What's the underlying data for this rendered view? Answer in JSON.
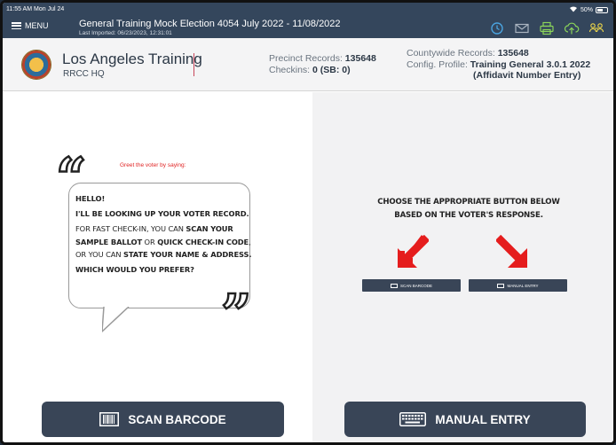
{
  "status_bar": {
    "time": "11:55 AM  Mon Jul 24",
    "battery": "50%"
  },
  "nav": {
    "menu_label": "MENU",
    "title": "General Training Mock Election 4054  July 2022  - 11/08/2022",
    "subtitle": "Last Imported: 06/23/2023, 12:31:01",
    "icons": [
      "history-icon",
      "mail-icon",
      "printer-icon",
      "cloud-upload-icon",
      "users-icon"
    ]
  },
  "info": {
    "org_name": "Los Angeles Training",
    "org_sub": "RRCC HQ",
    "precinct_label": "Precinct Records:",
    "precinct_value": "135648",
    "checkins_label": "Checkins:",
    "checkins_value": "0 (SB: 0)",
    "countywide_label": "Countywide Records:",
    "countywide_value": "135648",
    "config_label": "Config. Profile:",
    "config_value": "Training General 3.0.1 2022",
    "config_value_2": "(Affidavit Number Entry)"
  },
  "script": {
    "greet": "Greet the voter by saying:",
    "line1": "Hello!",
    "line2": "I'll be looking up your voter record.",
    "line3a": "For fast check-in, you can ",
    "line3b": "scan your sample ballot",
    "line3c": " or ",
    "line3d": "quick check-in code",
    "line3e": ", or you can ",
    "line3f": "state your name & address.",
    "line4": "Which would you prefer?"
  },
  "instruction": {
    "line1": "Choose the appropriate button below",
    "line2": "based on the voter's response.",
    "mini_scan": "SCAN BARCODE",
    "mini_manual": "MANUAL ENTRY"
  },
  "buttons": {
    "scan_barcode": "SCAN BARCODE",
    "manual_entry": "MANUAL ENTRY"
  },
  "colors": {
    "nav_bg": "#34465c",
    "button_bg": "#394557",
    "arrow_red": "#e51d1d",
    "icon_green": "#8bd45a",
    "icon_yellow": "#f1d949"
  }
}
